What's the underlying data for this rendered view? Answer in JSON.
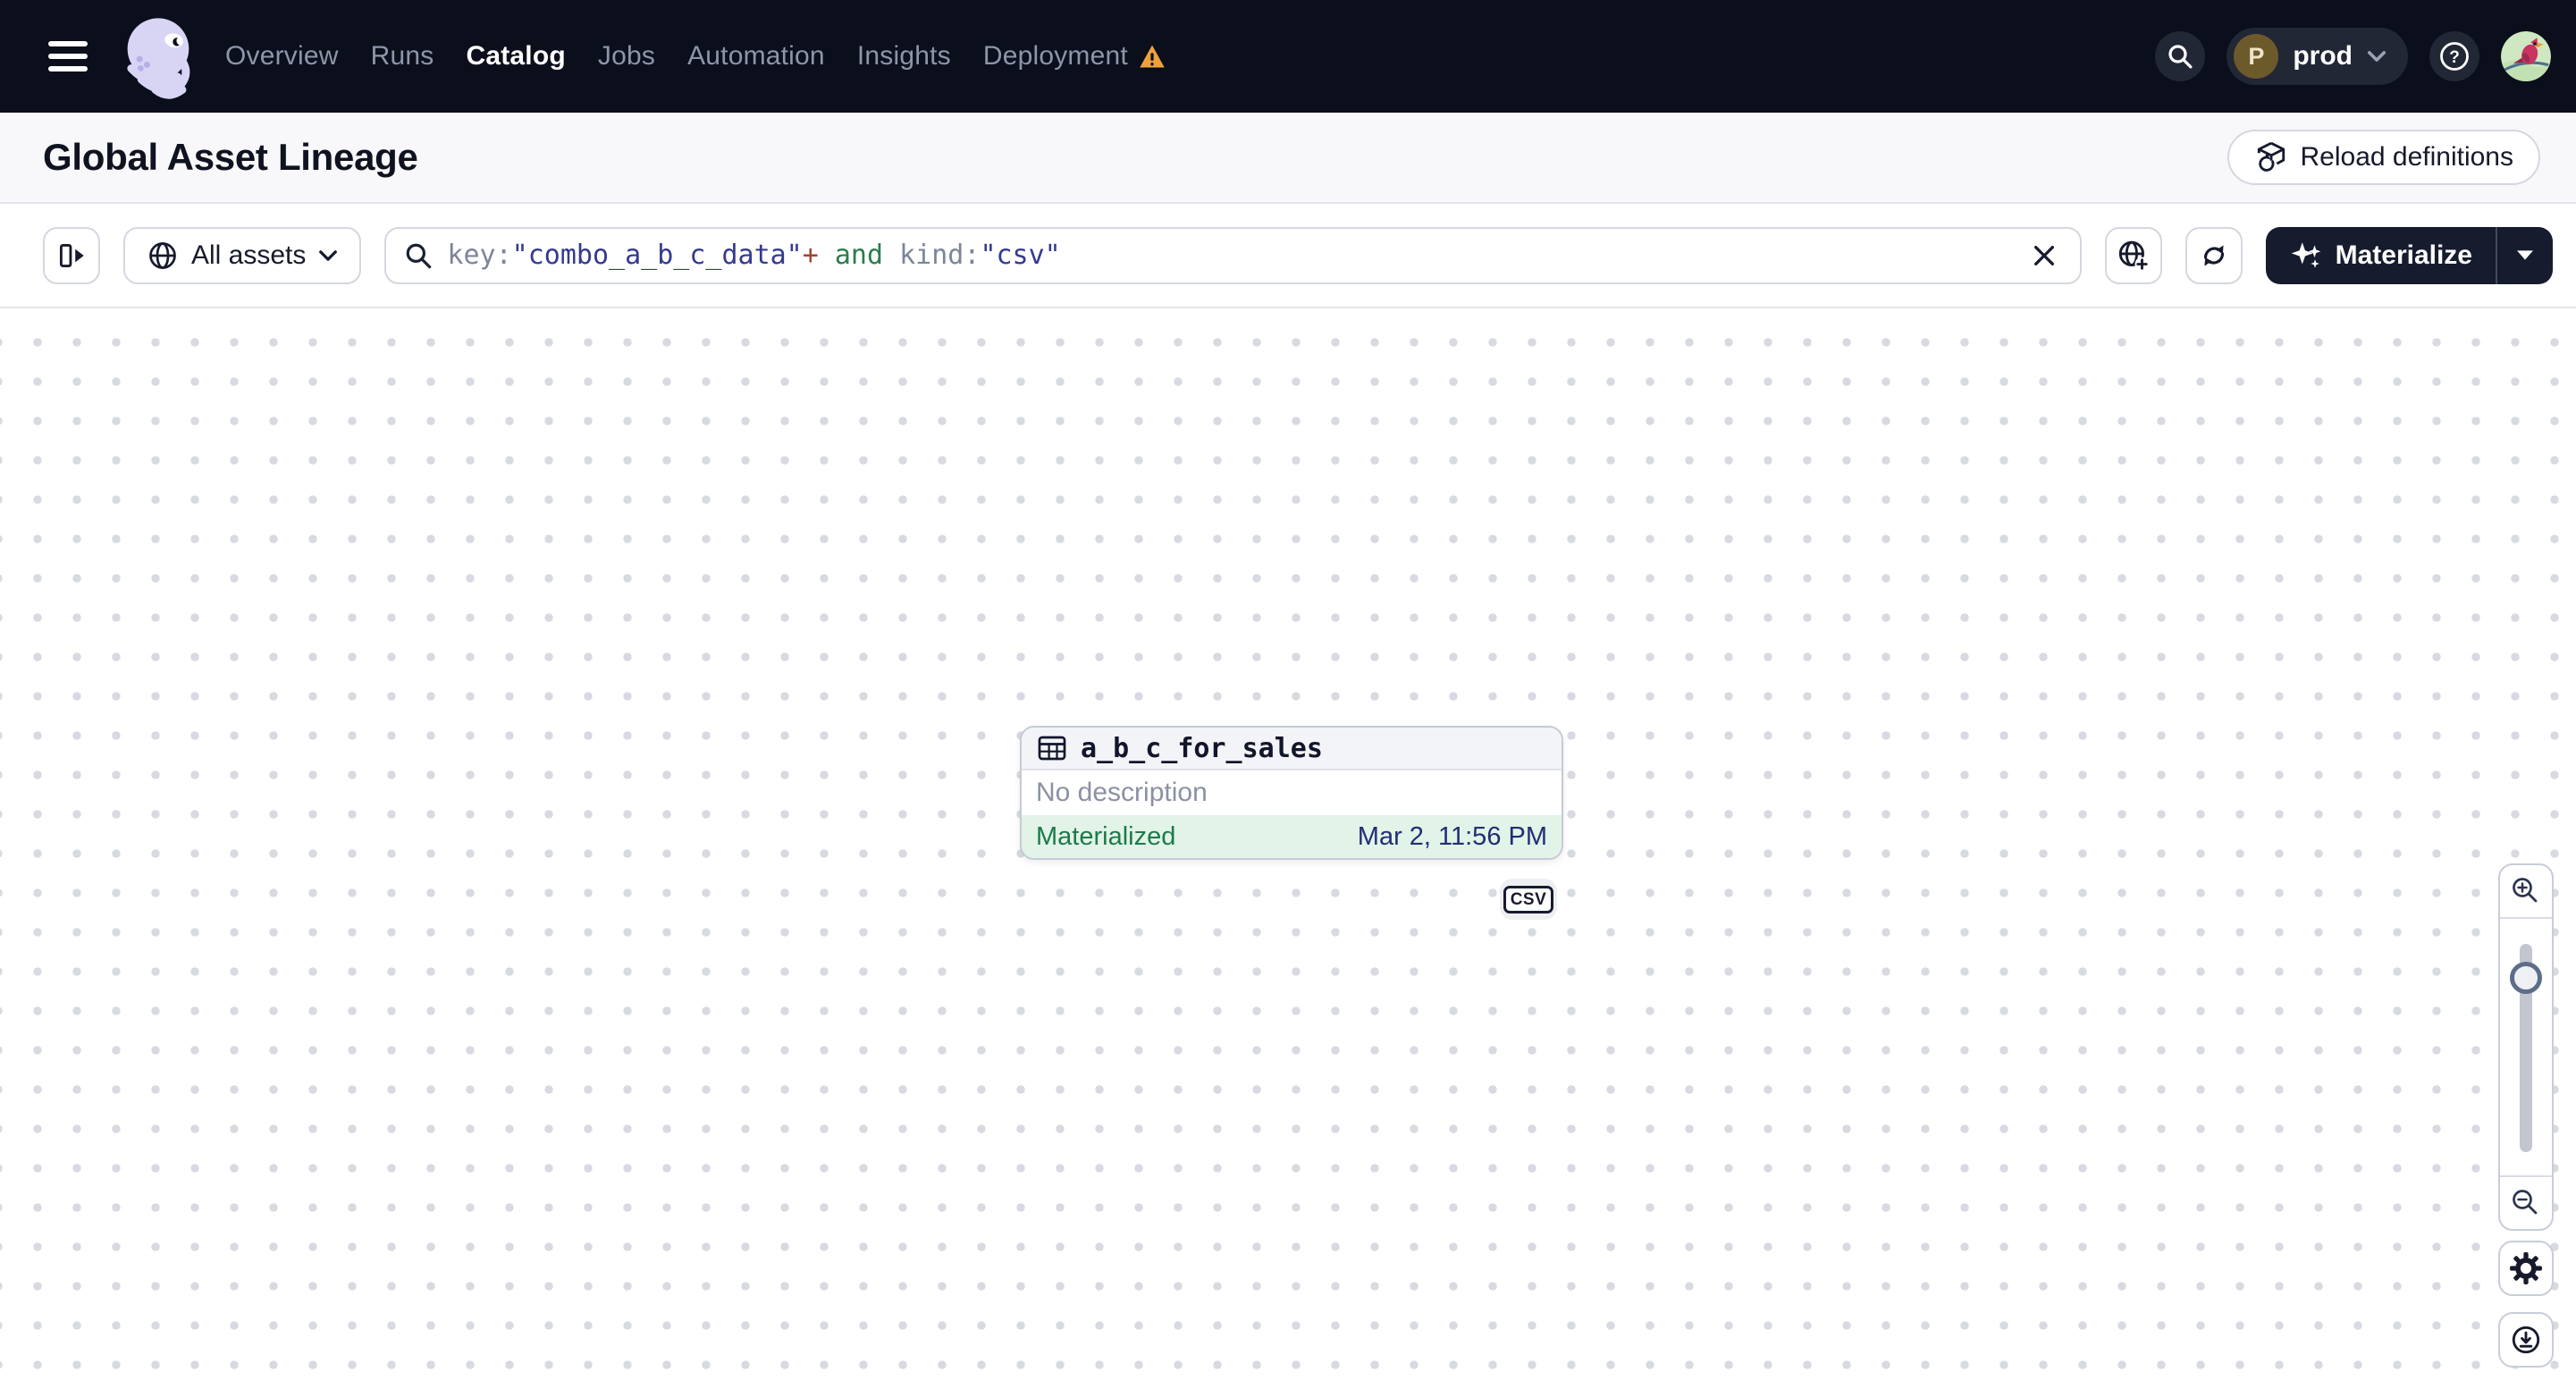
{
  "nav": {
    "items": [
      {
        "label": "Overview"
      },
      {
        "label": "Runs"
      },
      {
        "label": "Catalog"
      },
      {
        "label": "Jobs"
      },
      {
        "label": "Automation"
      },
      {
        "label": "Insights"
      },
      {
        "label": "Deployment"
      }
    ],
    "active_item": "Catalog",
    "environment": {
      "initial": "P",
      "name": "prod"
    }
  },
  "header": {
    "title": "Global Asset Lineage",
    "reload_button": "Reload definitions"
  },
  "toolbar": {
    "scope_button": "All assets",
    "query": {
      "segments": [
        {
          "text": "key:",
          "type": "field"
        },
        {
          "text": "\"combo_a_b_c_data\"",
          "type": "value"
        },
        {
          "text": "+",
          "type": "operator"
        },
        {
          "text": " and ",
          "type": "keyword"
        },
        {
          "text": "kind:",
          "type": "field"
        },
        {
          "text": "\"csv\"",
          "type": "value"
        }
      ]
    },
    "materialize_button": "Materialize"
  },
  "graph": {
    "node": {
      "name": "a_b_c_for_sales",
      "description": "No description",
      "status": "Materialized",
      "status_time": "Mar 2, 11:56 PM",
      "kind": "CSV"
    }
  },
  "colors": {
    "nav_bg": "#0b0e1b",
    "accent_dark": "#161b2e",
    "status_green": "#1d7a49",
    "status_green_bg": "#e2f3e8",
    "timestamp_blue": "#232d75",
    "query_field": "#7c8599",
    "query_value": "#34398f",
    "query_operator": "#9e4434",
    "query_keyword": "#2c7c4e",
    "warning_orange": "#efa13b"
  }
}
